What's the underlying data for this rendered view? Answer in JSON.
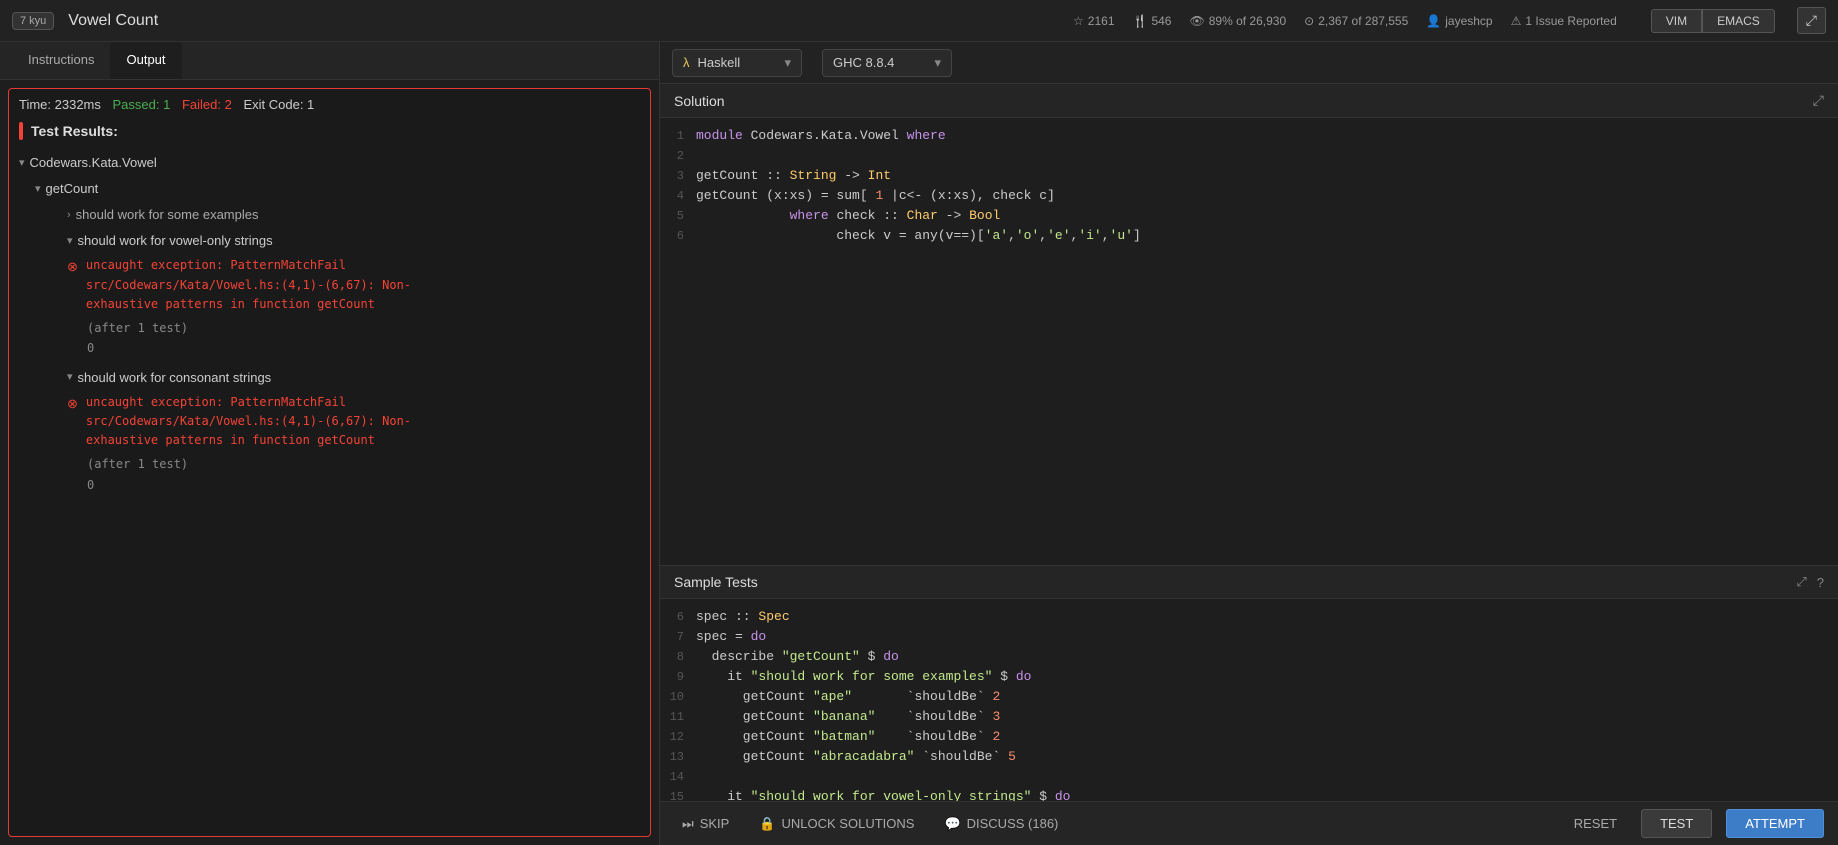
{
  "header": {
    "kyu": "7 kyu",
    "title": "Vowel Count",
    "stats": {
      "stars": "2161",
      "forks": "546",
      "completion": "89% of 26,930",
      "rank": "2,367 of 287,555",
      "user": "jayeshcp",
      "issues": "1 Issue Reported"
    },
    "vim_label": "VIM",
    "emacs_label": "EMACS"
  },
  "left_panel": {
    "tabs": [
      {
        "id": "instructions",
        "label": "Instructions",
        "active": false
      },
      {
        "id": "output",
        "label": "Output",
        "active": true
      }
    ],
    "results": {
      "time_prefix": "Time: ",
      "time_value": "2332ms",
      "passed_prefix": "Passed: ",
      "passed_value": "1",
      "failed_prefix": "Failed: ",
      "failed_value": "2",
      "exit_prefix": "Exit Code: ",
      "exit_value": "1",
      "header": "Test Results:",
      "tree": [
        {
          "label": "Codewars.Kata.Vowel",
          "level": 0,
          "expanded": true,
          "children": [
            {
              "label": "getCount",
              "level": 1,
              "expanded": true,
              "children": [
                {
                  "label": "should work for some examples",
                  "level": 2,
                  "status": "pass"
                },
                {
                  "label": "should work for vowel-only strings",
                  "level": 2,
                  "status": "fail",
                  "error": "uncaught exception: PatternMatchFail\nsrc/Codewars/Kata/Vowel.hs:(4,1)-(6,67): Non-\nexhaustive patterns in function getCount",
                  "after_text": "(after 1 test)",
                  "value": "0"
                },
                {
                  "label": "should work for consonant strings",
                  "level": 2,
                  "status": "fail",
                  "error": "uncaught exception: PatternMatchFail\nsrc/Codewars/Kata/Vowel.hs:(4,1)-(6,67): Non-\nexhaustive patterns in function getCount",
                  "after_text": "(after 1 test)",
                  "value": "0"
                }
              ]
            }
          ]
        }
      ]
    }
  },
  "right_panel": {
    "language_selector": {
      "lang": "Haskell",
      "version": "GHC 8.8.4"
    },
    "solution": {
      "title": "Solution",
      "lines": [
        {
          "num": "1",
          "code": "module Codewars.Kata.Vowel where"
        },
        {
          "num": "2",
          "code": ""
        },
        {
          "num": "3",
          "code": "getCount :: String -> Int"
        },
        {
          "num": "4",
          "code": "getCount (x:xs) = sum[ 1 |c<- (x:xs), check c]"
        },
        {
          "num": "5",
          "code": "            where check :: Char -> Bool"
        },
        {
          "num": "6",
          "code": "                  check v = any(v==)['a','o','e','i','u']"
        }
      ]
    },
    "sample_tests": {
      "title": "Sample Tests",
      "lines": [
        {
          "num": "6",
          "code": "spec :: Spec"
        },
        {
          "num": "7",
          "code": "spec = do"
        },
        {
          "num": "8",
          "code": "  describe \"getCount\" $ do"
        },
        {
          "num": "9",
          "code": "    it \"should work for some examples\" $ do"
        },
        {
          "num": "10",
          "code": "      getCount \"ape\"       `shouldBe` 2"
        },
        {
          "num": "11",
          "code": "      getCount \"banana\"    `shouldBe` 3"
        },
        {
          "num": "12",
          "code": "      getCount \"batman\"    `shouldBe` 2"
        },
        {
          "num": "13",
          "code": "      getCount \"abracadabra\" `shouldBe` 5"
        },
        {
          "num": "14",
          "code": ""
        },
        {
          "num": "15",
          "code": "    it \"should work for vowel-only strings\" $ do"
        }
      ]
    },
    "bottom_bar": {
      "skip_label": "SKIP",
      "unlock_label": "UNLOCK SOLUTIONS",
      "discuss_label": "DISCUSS (186)",
      "reset_label": "RESET",
      "test_label": "TEST",
      "attempt_label": "ATTEMPT"
    }
  }
}
